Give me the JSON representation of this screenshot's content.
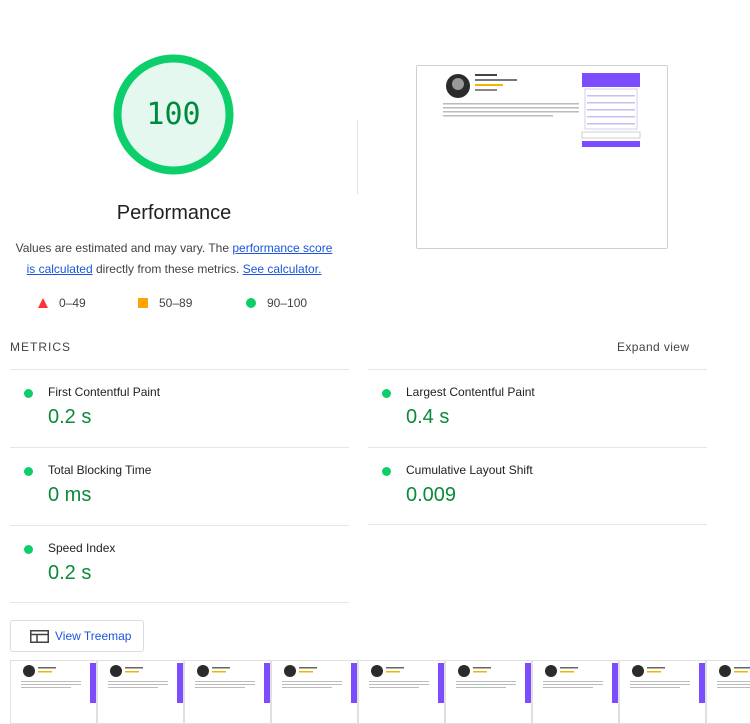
{
  "score": {
    "value": "100",
    "label": "Performance",
    "percent": 100
  },
  "description": {
    "text_before": "Values are estimated and may vary. The ",
    "link_score": "performance score is calculated",
    "text_middle": " directly from these metrics. ",
    "link_calculator": "See calculator."
  },
  "legend": [
    {
      "shape": "triangle",
      "label": "0–49",
      "color": "#ff3333"
    },
    {
      "shape": "square",
      "label": "50–89",
      "color": "#ffa400"
    },
    {
      "shape": "circle",
      "label": "90–100",
      "color": "#0cce6b"
    }
  ],
  "metrics": {
    "title": "METRICS",
    "expand_label": "Expand view",
    "items": [
      {
        "name": "First Contentful Paint",
        "value": "0.2 s"
      },
      {
        "name": "Largest Contentful Paint",
        "value": "0.4 s"
      },
      {
        "name": "Total Blocking Time",
        "value": "0 ms"
      },
      {
        "name": "Cumulative Layout Shift",
        "value": "0.009"
      },
      {
        "name": "Speed Index",
        "value": "0.2 s"
      }
    ]
  },
  "treemap_button": {
    "label": "View Treemap",
    "icon": "treemap-icon"
  },
  "colors": {
    "pass": "#0cce6b",
    "pass_text": "#008a3e",
    "gauge_fill": "#e5f8ef",
    "link": "#1a56db",
    "accent_purple": "#7c4dff"
  }
}
